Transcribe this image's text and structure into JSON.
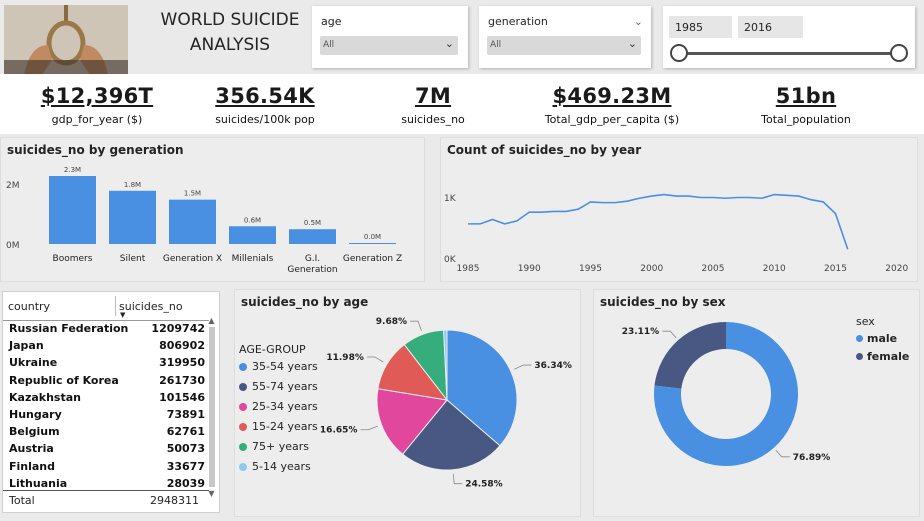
{
  "header": {
    "title_line1": "WORLD SUICIDE",
    "title_line2": "ANALYSIS",
    "image_icon": "rope-hands-image"
  },
  "slicers": {
    "age": {
      "label": "age",
      "value": "All"
    },
    "generation": {
      "label": "generation",
      "value": "All"
    },
    "year": {
      "start": "1985",
      "end": "2016"
    }
  },
  "kpis": [
    {
      "value": "$12,396T",
      "label": "gdp_for_year ($)"
    },
    {
      "value": "356.54K",
      "label": "suicides/100k pop"
    },
    {
      "value": "7M",
      "label": "suicides_no"
    },
    {
      "value": "$469.23M",
      "label": "Total_gdp_per_capita ($)"
    },
    {
      "value": "51bn",
      "label": "Total_population"
    }
  ],
  "gen_chart": {
    "title": "suicides_no by generation",
    "y_ticks": [
      "2M",
      "0M"
    ]
  },
  "year_chart": {
    "title": "Count of suicides_no by year",
    "y_ticks": [
      "1K",
      "0K"
    ],
    "x_ticks": [
      "1985",
      "1990",
      "1995",
      "2000",
      "2005",
      "2010",
      "2015",
      "2020"
    ]
  },
  "table": {
    "headers": [
      "country",
      "suicides_no"
    ],
    "rows": [
      [
        "Russian Federation",
        "1209742"
      ],
      [
        "Japan",
        "806902"
      ],
      [
        "Ukraine",
        "319950"
      ],
      [
        "Republic of Korea",
        "261730"
      ],
      [
        "Kazakhstan",
        "101546"
      ],
      [
        "Hungary",
        "73891"
      ],
      [
        "Belgium",
        "62761"
      ],
      [
        "Austria",
        "50073"
      ],
      [
        "Finland",
        "33677"
      ],
      [
        "Lithuania",
        "28039"
      ]
    ],
    "total_label": "Total",
    "total_value": "2948311"
  },
  "age_chart": {
    "title": "suicides_no by age",
    "legend_title": "AGE-GROUP"
  },
  "sex_chart": {
    "title": "suicides_no by sex",
    "legend_title": "sex"
  },
  "chart_data": [
    {
      "type": "bar",
      "title": "suicides_no by generation",
      "categories": [
        "Boomers",
        "Silent",
        "Generation X",
        "Millenials",
        "G.I. Generation",
        "Generation Z"
      ],
      "category_labels": [
        [
          "Boomers"
        ],
        [
          "Silent"
        ],
        [
          "Generation X"
        ],
        [
          "Millenials"
        ],
        [
          "G.I.",
          "Generation"
        ],
        [
          "Generation Z"
        ]
      ],
      "values": [
        2.3,
        1.8,
        1.5,
        0.6,
        0.5,
        0.0
      ],
      "data_labels": [
        "2.3M",
        "1.8M",
        "1.5M",
        "0.6M",
        "0.5M",
        "0.0M"
      ],
      "ylim": [
        0,
        2.3
      ],
      "color": "#4a90e2",
      "grid": false
    },
    {
      "type": "line",
      "title": "Count of suicides_no by year",
      "x": [
        1985,
        1986,
        1987,
        1988,
        1989,
        1990,
        1991,
        1992,
        1993,
        1994,
        1995,
        1996,
        1997,
        1998,
        1999,
        2000,
        2001,
        2002,
        2003,
        2004,
        2005,
        2006,
        2007,
        2008,
        2009,
        2010,
        2011,
        2012,
        2013,
        2014,
        2015,
        2016
      ],
      "y": [
        576,
        576,
        648,
        576,
        624,
        768,
        768,
        780,
        780,
        816,
        936,
        924,
        924,
        948,
        996,
        1032,
        1056,
        1032,
        1032,
        1008,
        1008,
        996,
        1008,
        1008,
        996,
        1056,
        1044,
        1032,
        972,
        936,
        744,
        160
      ],
      "xlim": [
        1984,
        2020
      ],
      "ylim": [
        0,
        1000
      ],
      "color": "#4a90e2"
    },
    {
      "type": "pie",
      "title": "suicides_no by age",
      "labels": [
        "35-54 years",
        "55-74 years",
        "25-34 years",
        "15-24 years",
        "75+ years",
        "5-14 years"
      ],
      "values": [
        36.34,
        24.58,
        16.65,
        11.98,
        9.68,
        0.77
      ],
      "data_labels": [
        "36.34%",
        "24.58%",
        "16.65%",
        "11.98%",
        "9.68%",
        ""
      ],
      "colors": [
        "#4a90e2",
        "#485883",
        "#e1479d",
        "#e05a57",
        "#35ad7c",
        "#8cc8ef"
      ]
    },
    {
      "type": "donut",
      "title": "suicides_no by sex",
      "labels": [
        "male",
        "female"
      ],
      "values": [
        76.89,
        23.11
      ],
      "data_labels": [
        "76.89%",
        "23.11%"
      ],
      "colors": [
        "#4a90e2",
        "#485883"
      ]
    }
  ]
}
